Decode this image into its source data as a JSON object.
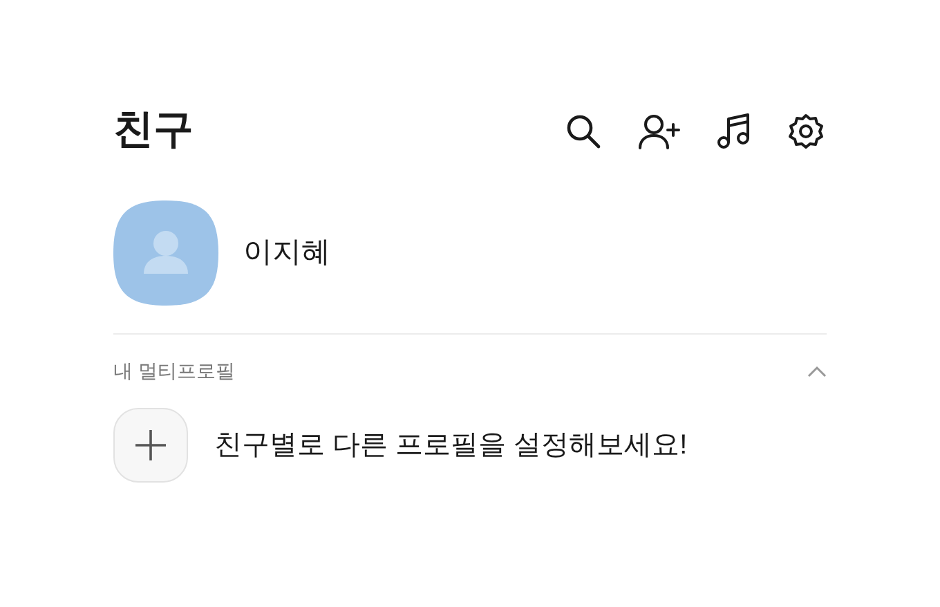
{
  "header": {
    "title": "친구"
  },
  "profile": {
    "name": "이지혜"
  },
  "multi_profile": {
    "label": "내 멀티프로필",
    "expanded": true,
    "prompt": "친구별로 다른 프로필을 설정해보세요!"
  }
}
